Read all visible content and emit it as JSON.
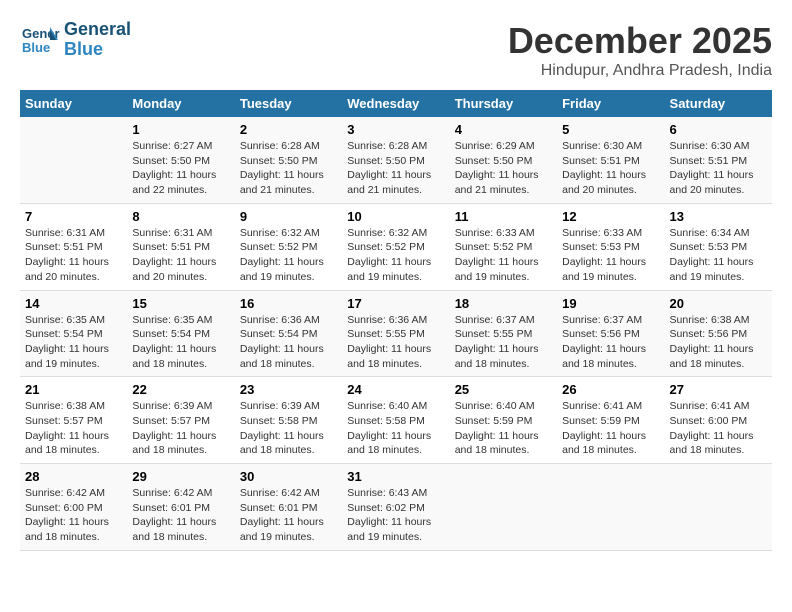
{
  "logo": {
    "line1": "General",
    "line2": "Blue"
  },
  "title": "December 2025",
  "subtitle": "Hindupur, Andhra Pradesh, India",
  "headers": [
    "Sunday",
    "Monday",
    "Tuesday",
    "Wednesday",
    "Thursday",
    "Friday",
    "Saturday"
  ],
  "weeks": [
    [
      {
        "day": "",
        "info": ""
      },
      {
        "day": "1",
        "info": "Sunrise: 6:27 AM\nSunset: 5:50 PM\nDaylight: 11 hours and 22 minutes."
      },
      {
        "day": "2",
        "info": "Sunrise: 6:28 AM\nSunset: 5:50 PM\nDaylight: 11 hours and 21 minutes."
      },
      {
        "day": "3",
        "info": "Sunrise: 6:28 AM\nSunset: 5:50 PM\nDaylight: 11 hours and 21 minutes."
      },
      {
        "day": "4",
        "info": "Sunrise: 6:29 AM\nSunset: 5:50 PM\nDaylight: 11 hours and 21 minutes."
      },
      {
        "day": "5",
        "info": "Sunrise: 6:30 AM\nSunset: 5:51 PM\nDaylight: 11 hours and 20 minutes."
      },
      {
        "day": "6",
        "info": "Sunrise: 6:30 AM\nSunset: 5:51 PM\nDaylight: 11 hours and 20 minutes."
      }
    ],
    [
      {
        "day": "7",
        "info": "Sunrise: 6:31 AM\nSunset: 5:51 PM\nDaylight: 11 hours and 20 minutes."
      },
      {
        "day": "8",
        "info": "Sunrise: 6:31 AM\nSunset: 5:51 PM\nDaylight: 11 hours and 20 minutes."
      },
      {
        "day": "9",
        "info": "Sunrise: 6:32 AM\nSunset: 5:52 PM\nDaylight: 11 hours and 19 minutes."
      },
      {
        "day": "10",
        "info": "Sunrise: 6:32 AM\nSunset: 5:52 PM\nDaylight: 11 hours and 19 minutes."
      },
      {
        "day": "11",
        "info": "Sunrise: 6:33 AM\nSunset: 5:52 PM\nDaylight: 11 hours and 19 minutes."
      },
      {
        "day": "12",
        "info": "Sunrise: 6:33 AM\nSunset: 5:53 PM\nDaylight: 11 hours and 19 minutes."
      },
      {
        "day": "13",
        "info": "Sunrise: 6:34 AM\nSunset: 5:53 PM\nDaylight: 11 hours and 19 minutes."
      }
    ],
    [
      {
        "day": "14",
        "info": "Sunrise: 6:35 AM\nSunset: 5:54 PM\nDaylight: 11 hours and 19 minutes."
      },
      {
        "day": "15",
        "info": "Sunrise: 6:35 AM\nSunset: 5:54 PM\nDaylight: 11 hours and 18 minutes."
      },
      {
        "day": "16",
        "info": "Sunrise: 6:36 AM\nSunset: 5:54 PM\nDaylight: 11 hours and 18 minutes."
      },
      {
        "day": "17",
        "info": "Sunrise: 6:36 AM\nSunset: 5:55 PM\nDaylight: 11 hours and 18 minutes."
      },
      {
        "day": "18",
        "info": "Sunrise: 6:37 AM\nSunset: 5:55 PM\nDaylight: 11 hours and 18 minutes."
      },
      {
        "day": "19",
        "info": "Sunrise: 6:37 AM\nSunset: 5:56 PM\nDaylight: 11 hours and 18 minutes."
      },
      {
        "day": "20",
        "info": "Sunrise: 6:38 AM\nSunset: 5:56 PM\nDaylight: 11 hours and 18 minutes."
      }
    ],
    [
      {
        "day": "21",
        "info": "Sunrise: 6:38 AM\nSunset: 5:57 PM\nDaylight: 11 hours and 18 minutes."
      },
      {
        "day": "22",
        "info": "Sunrise: 6:39 AM\nSunset: 5:57 PM\nDaylight: 11 hours and 18 minutes."
      },
      {
        "day": "23",
        "info": "Sunrise: 6:39 AM\nSunset: 5:58 PM\nDaylight: 11 hours and 18 minutes."
      },
      {
        "day": "24",
        "info": "Sunrise: 6:40 AM\nSunset: 5:58 PM\nDaylight: 11 hours and 18 minutes."
      },
      {
        "day": "25",
        "info": "Sunrise: 6:40 AM\nSunset: 5:59 PM\nDaylight: 11 hours and 18 minutes."
      },
      {
        "day": "26",
        "info": "Sunrise: 6:41 AM\nSunset: 5:59 PM\nDaylight: 11 hours and 18 minutes."
      },
      {
        "day": "27",
        "info": "Sunrise: 6:41 AM\nSunset: 6:00 PM\nDaylight: 11 hours and 18 minutes."
      }
    ],
    [
      {
        "day": "28",
        "info": "Sunrise: 6:42 AM\nSunset: 6:00 PM\nDaylight: 11 hours and 18 minutes."
      },
      {
        "day": "29",
        "info": "Sunrise: 6:42 AM\nSunset: 6:01 PM\nDaylight: 11 hours and 18 minutes."
      },
      {
        "day": "30",
        "info": "Sunrise: 6:42 AM\nSunset: 6:01 PM\nDaylight: 11 hours and 19 minutes."
      },
      {
        "day": "31",
        "info": "Sunrise: 6:43 AM\nSunset: 6:02 PM\nDaylight: 11 hours and 19 minutes."
      },
      {
        "day": "",
        "info": ""
      },
      {
        "day": "",
        "info": ""
      },
      {
        "day": "",
        "info": ""
      }
    ]
  ]
}
